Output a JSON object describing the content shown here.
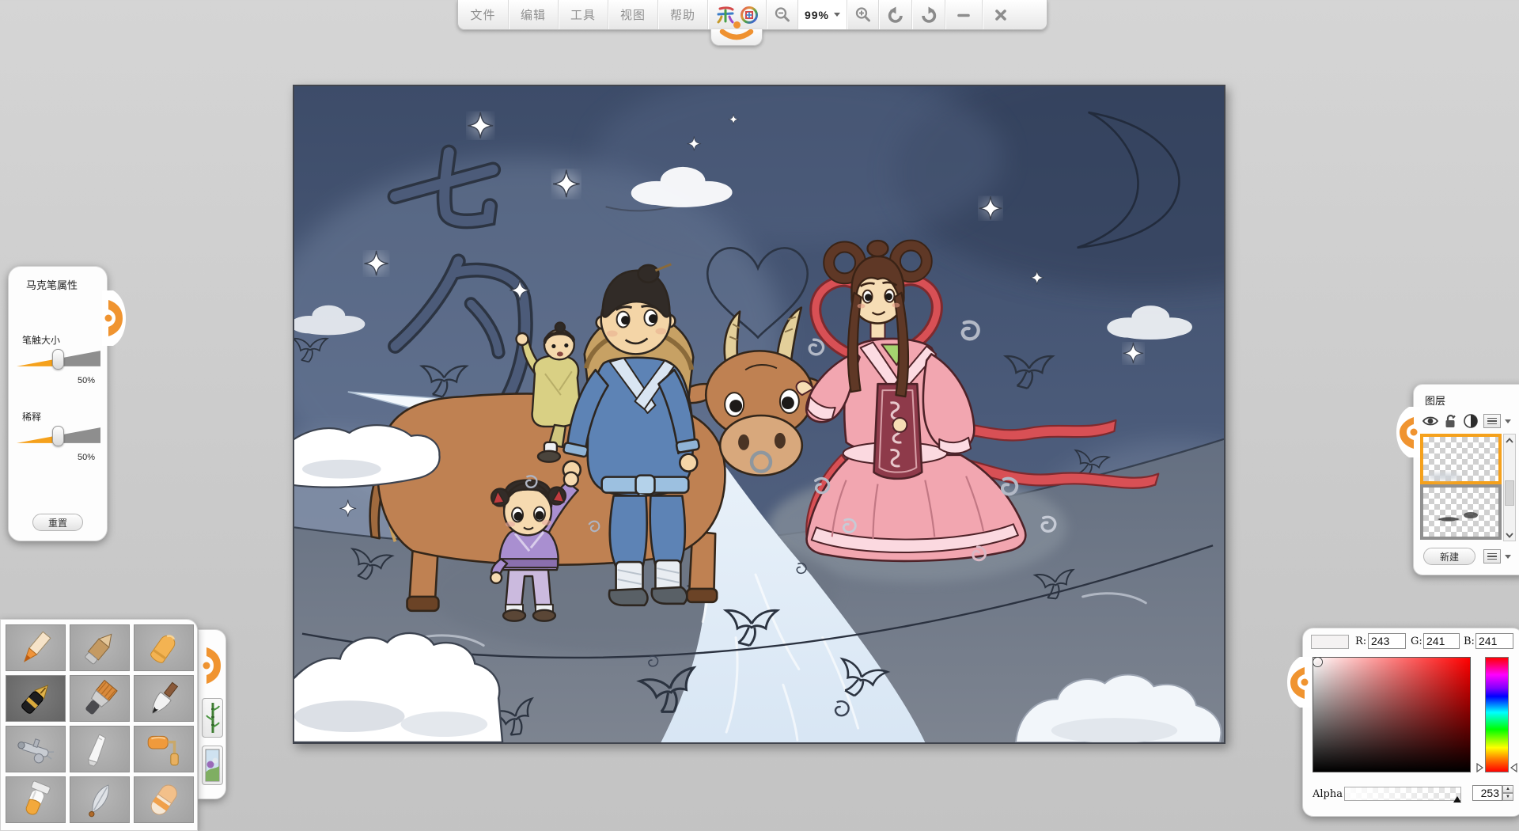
{
  "colors": {
    "accent": "#f5a11c",
    "slider_track": "#8e8e8e",
    "selected_layer_border": "#f5a11c",
    "layer_border": "#909090"
  },
  "toolbar": {
    "menus": [
      {
        "label": "文件"
      },
      {
        "label": "编辑"
      },
      {
        "label": "工具"
      },
      {
        "label": "视图"
      },
      {
        "label": "帮助"
      }
    ],
    "zoom_level": "99%",
    "icons": [
      "app-logo-left-glyph",
      "app-logo-right-glyph",
      "zoom-out",
      "zoom-in",
      "undo",
      "redo",
      "minimize",
      "close"
    ]
  },
  "marker_panel": {
    "title": "马克笔属性",
    "sliders": [
      {
        "label": "笔触大小",
        "value": "50%",
        "percent": 50
      },
      {
        "label": "稀释",
        "value": "50%",
        "percent": 50
      }
    ],
    "reset_label": "重置"
  },
  "brush_panel": {
    "selected_index": 3,
    "tools": [
      "colored-pencil",
      "pastel-stick",
      "crayon",
      "fountain-pen",
      "flat-brush",
      "ink-brush",
      "airbrush",
      "palette-knife",
      "paint-roller",
      "paint-tube",
      "blade-quill",
      "eraser"
    ],
    "side_buttons": [
      "bamboo-texture",
      "picture-texture"
    ]
  },
  "layers_panel": {
    "title": "图层",
    "toolbar_icons": [
      "visibility-eye",
      "unlocked-padlock",
      "blend-half-circle",
      "layer-menu"
    ],
    "layers": [
      {
        "name": "layer-1",
        "selected": true
      },
      {
        "name": "layer-2",
        "selected": false
      }
    ],
    "new_button_label": "新建"
  },
  "color_panel": {
    "r_label": "R:",
    "g_label": "G:",
    "b_label": "B:",
    "r": "243",
    "g": "241",
    "b": "241",
    "alpha_label": "Alpha",
    "alpha": "253",
    "alpha_max": 255,
    "swatch_color": "#f4f2f2"
  },
  "canvas": {
    "zoom": "99%",
    "sketch_characters": [
      "七",
      "夕"
    ],
    "scene": "Qixi legend: cowherd with two children and ox meeting the weaver girl on clouds over the milky way"
  }
}
